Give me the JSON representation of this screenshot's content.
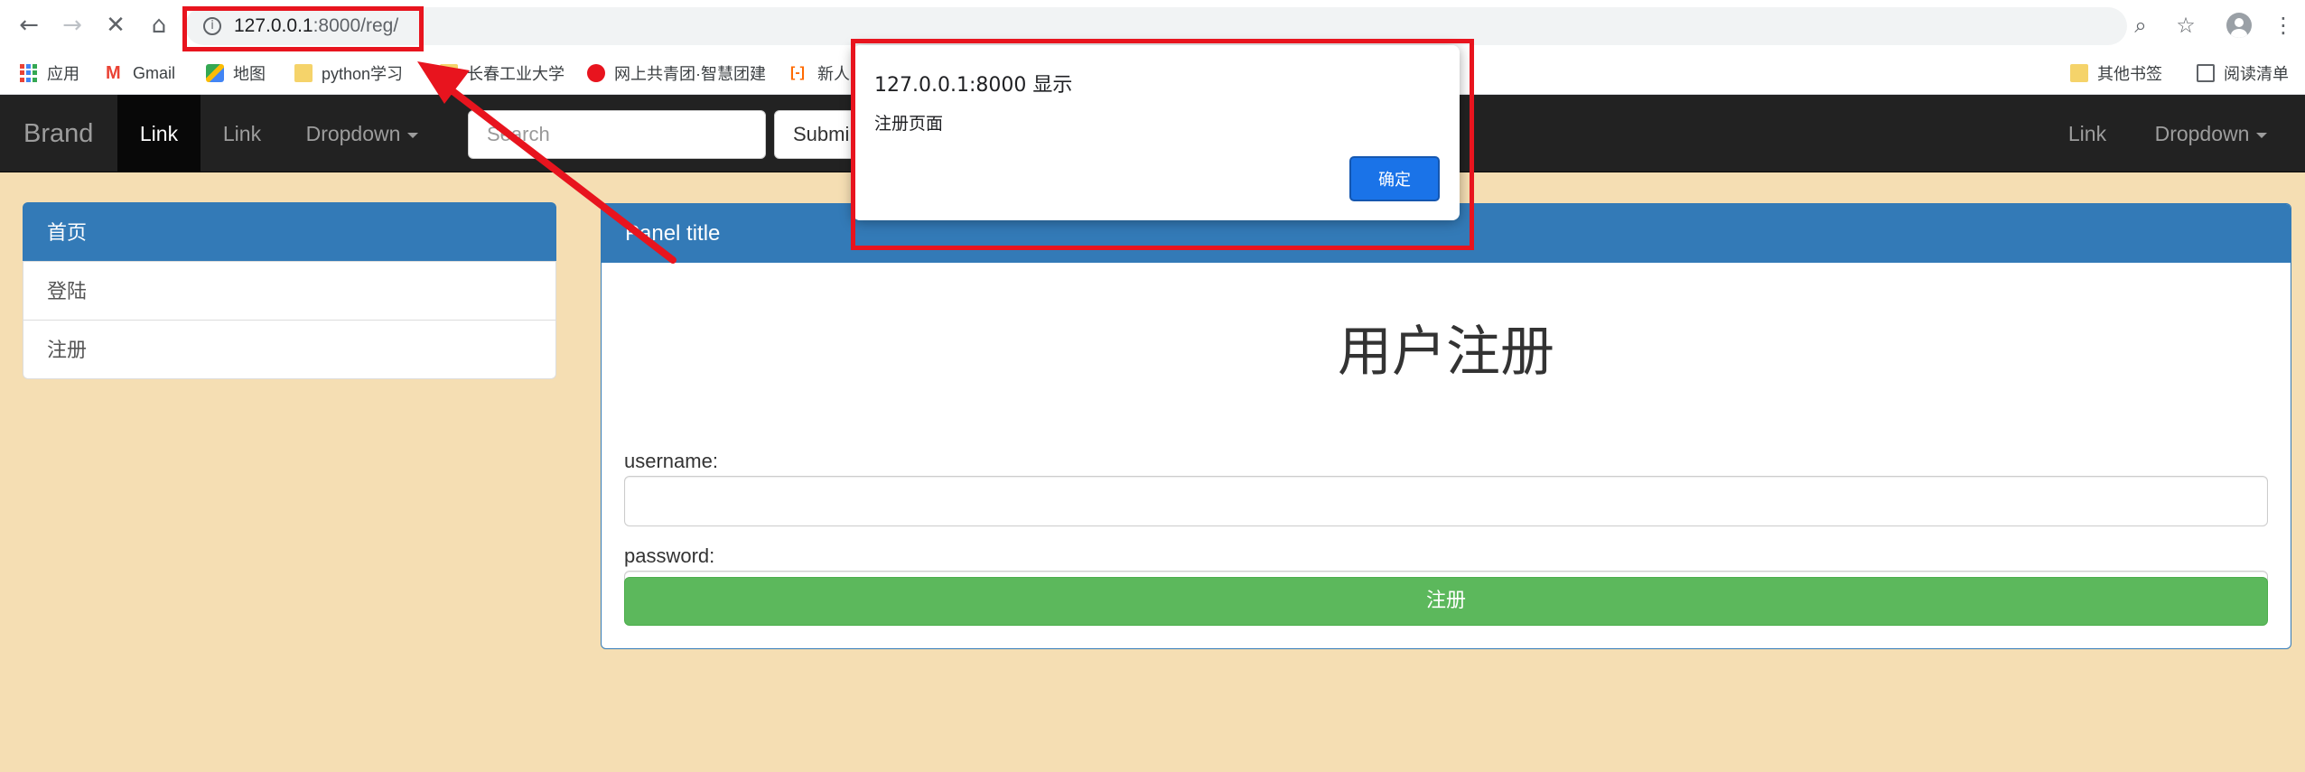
{
  "browser": {
    "url_host": "127.0.0.1",
    "url_rest": ":8000/reg/",
    "bookmarks": [
      {
        "label": "应用",
        "icon": "apps-grid-icon"
      },
      {
        "label": "Gmail",
        "icon": "gmail-icon"
      },
      {
        "label": "地图",
        "icon": "maps-icon"
      },
      {
        "label": "python学习",
        "icon": "folder-icon"
      },
      {
        "label": "长春工业大学",
        "icon": "folder-icon"
      },
      {
        "label": "网上共青团·智慧团建",
        "icon": "youth-league-icon"
      },
      {
        "label": "新人",
        "icon": "alibaba-icon"
      }
    ],
    "other_bookmarks": "其他书签",
    "reading_list": "阅读清单"
  },
  "navbar": {
    "brand": "Brand",
    "link_active": "Link",
    "link_2": "Link",
    "dropdown_left": "Dropdown",
    "search_placeholder": "Search",
    "submit_label": "Submi",
    "link_right": "Link",
    "dropdown_right": "Dropdown"
  },
  "sidebar": {
    "items": [
      {
        "label": "首页",
        "active": true
      },
      {
        "label": "登陆",
        "active": false
      },
      {
        "label": "注册",
        "active": false
      }
    ]
  },
  "panel": {
    "title": "Panel title",
    "heading": "用户注册",
    "username_label": "username:",
    "password_label": "password:",
    "submit_label": "注册"
  },
  "dialog": {
    "title": "127.0.0.1:8000 显示",
    "message": "注册页面",
    "ok_label": "确定"
  },
  "colors": {
    "page_bg": "#f5deb3",
    "navbar_bg": "#222222",
    "primary": "#337ab7",
    "success": "#5cb85c",
    "annotation_red": "#e8141e",
    "dialog_button": "#1a73e8"
  }
}
